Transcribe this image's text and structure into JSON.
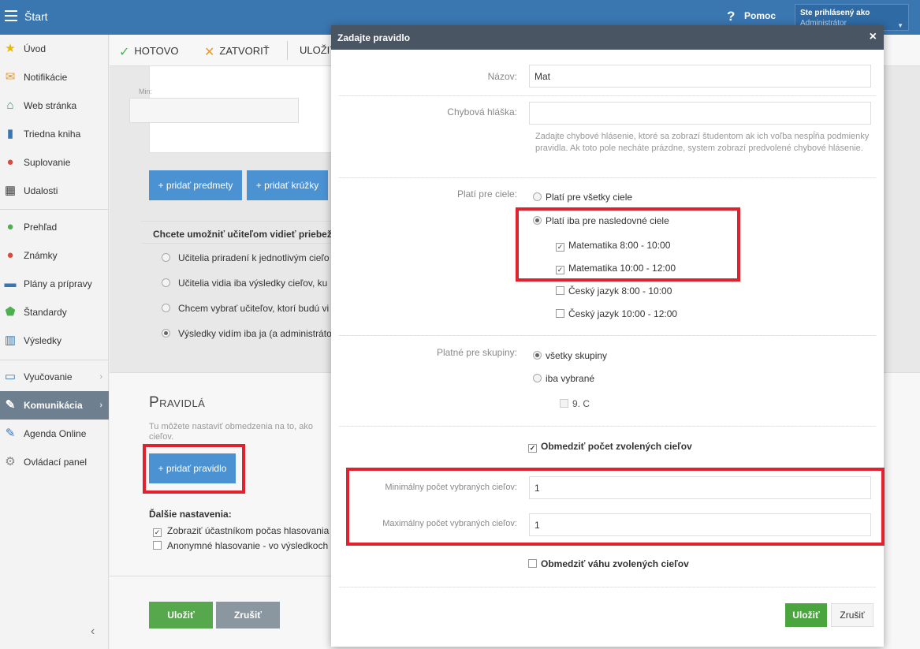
{
  "topbar": {
    "start_label": "Štart",
    "help_label": "Pomoc",
    "user_line1": "Ste prihlásený ako",
    "user_line2": "Administrátor"
  },
  "sidebar": {
    "items": [
      {
        "label": "Úvod",
        "icon": "star-icon",
        "glyph": "★",
        "color": "#e6b800"
      },
      {
        "label": "Notifikácie",
        "icon": "envelope-icon",
        "glyph": "✉",
        "color": "#e89a2c"
      },
      {
        "label": "Web stránka",
        "icon": "home-icon",
        "glyph": "⌂",
        "color": "#3b8f6e"
      },
      {
        "label": "Triedna kniha",
        "icon": "book-icon",
        "glyph": "▮",
        "color": "#3a76b0"
      },
      {
        "label": "Suplovanie",
        "icon": "person-icon",
        "glyph": "●",
        "color": "#d94b3b"
      },
      {
        "label": "Udalosti",
        "icon": "calendar-icon",
        "glyph": "▦",
        "color": "#444"
      },
      {
        "label": "Prehľad",
        "icon": "check-circle-icon",
        "glyph": "●",
        "color": "#4caf50"
      },
      {
        "label": "Známky",
        "icon": "grade-icon",
        "glyph": "●",
        "color": "#d94b3b"
      },
      {
        "label": "Plány a prípravy",
        "icon": "briefcase-icon",
        "glyph": "▬",
        "color": "#3a76b0"
      },
      {
        "label": "Štandardy",
        "icon": "shield-icon",
        "glyph": "⬟",
        "color": "#4caf50"
      },
      {
        "label": "Výsledky",
        "icon": "bar-chart-icon",
        "glyph": "▥",
        "color": "#3a76b0"
      },
      {
        "label": "Vyučovanie",
        "icon": "book-open-icon",
        "glyph": "▭",
        "color": "#3a76b0"
      },
      {
        "label": "Komunikácia",
        "icon": "chat-icon",
        "glyph": "✎",
        "color": "#ffffff"
      },
      {
        "label": "Agenda Online",
        "icon": "pen-icon",
        "glyph": "✎",
        "color": "#3a76b0"
      },
      {
        "label": "Ovládací panel",
        "icon": "gear-icon",
        "glyph": "⚙",
        "color": "#888"
      }
    ]
  },
  "toolbar": {
    "done_label": "HOTOVO",
    "close_label": "ZATVORIŤ",
    "save_label": "ULOŽIŤ"
  },
  "main": {
    "min_label": "Min:",
    "add_subjects": "+ pridať predmety",
    "add_clubs": "+ pridať krúžky",
    "question": "Chcete umožniť učiteľom vidieť priebež",
    "radios": [
      {
        "label": "Učitelia priradení k jednotlivým cieľo",
        "checked": false
      },
      {
        "label": "Učitelia vidia iba výsledky cieľov, ku",
        "checked": false
      },
      {
        "label": "Chcem vybrať učiteľov, ktorí budú vi",
        "checked": false
      },
      {
        "label": "Výsledky vidím iba ja (a administráto",
        "checked": true
      }
    ],
    "rules_title": "Pravidlá",
    "rules_desc": "Tu môžete nastaviť obmedzenia na to, ako cieľov.",
    "add_rule": "+ pridať pravidlo",
    "further_label": "Ďalšie nastavenia:",
    "further": [
      {
        "label": "Zobraziť účastníkom počas hlasovania",
        "checked": true
      },
      {
        "label": "Anonymné hlasovanie - vo výsledkoch",
        "checked": false
      }
    ],
    "save_btn": "Uložiť",
    "cancel_btn": "Zrušiť"
  },
  "dialog": {
    "title": "Zadajte pravidlo",
    "name_label": "Názov:",
    "name_value": "Mat",
    "error_label": "Chybová hláška:",
    "error_value": "",
    "help_text": "Zadajte chybové hlásenie, ktoré sa zobrazí študentom ak ich voľba nespĺňa podmienky pravidla. Ak toto pole necháte prázdne, system zobrazí predvolené chybové hlásenie.",
    "targets_label": "Platí pre ciele:",
    "target_all": "Platí pre všetky ciele",
    "target_only": "Platí iba pre nasledovné ciele",
    "targets": [
      {
        "label": "Matematika 8:00 - 10:00",
        "checked": true
      },
      {
        "label": "Matematika 10:00 - 12:00",
        "checked": true
      },
      {
        "label": "Český jazyk 8:00 - 10:00",
        "checked": false
      },
      {
        "label": "Český jazyk 10:00 - 12:00",
        "checked": false
      }
    ],
    "groups_label": "Platné pre skupiny:",
    "group_all": "všetky skupiny",
    "group_selected": "iba vybrané",
    "group_item": "9. C",
    "limit_count": "Obmedziť počet zvolených cieľov",
    "min_label": "Minimálny počet vybraných cieľov:",
    "min_value": "1",
    "max_label": "Maximálny počet vybraných cieľov:",
    "max_value": "1",
    "limit_weight": "Obmedziť váhu zvolených cieľov",
    "ok_btn": "Uložiť",
    "cancel_btn": "Zrušiť"
  },
  "colors": {
    "accent": "#3a76b0",
    "highlight": "#e0222f",
    "success": "#57a84c"
  }
}
